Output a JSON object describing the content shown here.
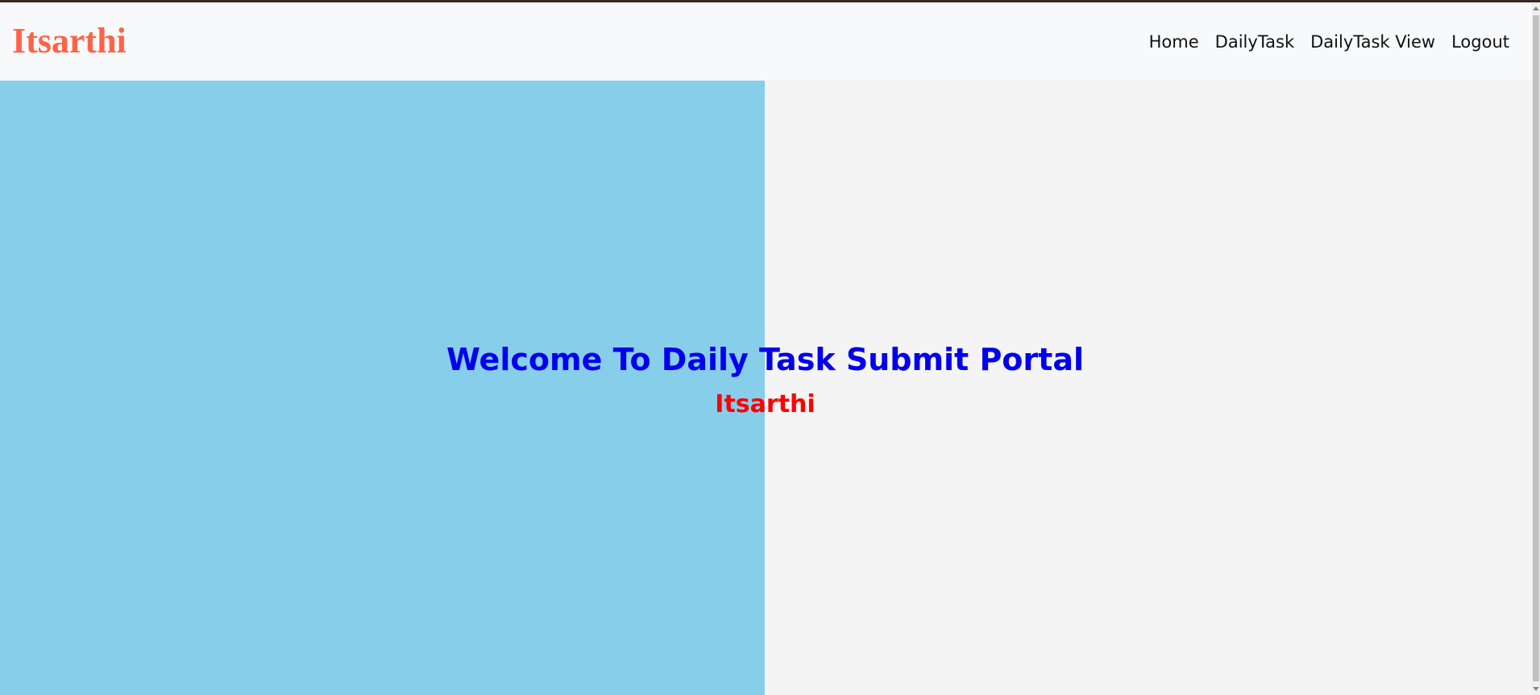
{
  "navbar": {
    "brand": "Itsarthi",
    "links": [
      {
        "label": "Home"
      },
      {
        "label": "DailyTask"
      },
      {
        "label": "DailyTask View"
      },
      {
        "label": "Logout"
      }
    ]
  },
  "main": {
    "heading": "Welcome To Daily Task Submit Portal",
    "subheading": "Itsarthi"
  },
  "colors": {
    "brand": "#ff6347",
    "left_panel": "#87ceeb",
    "right_panel": "#f4f4f4",
    "heading": "#0000ee",
    "subheading": "#ff0000"
  }
}
